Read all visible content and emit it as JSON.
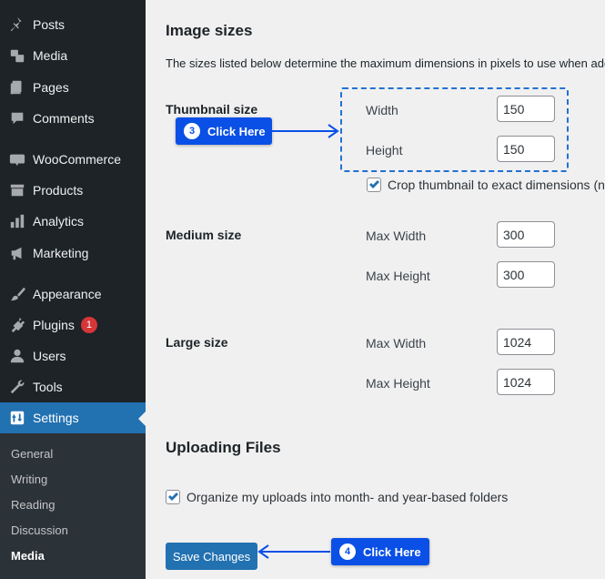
{
  "sidebar": {
    "items": [
      {
        "label": "Posts",
        "icon": "pin-icon"
      },
      {
        "label": "Media",
        "icon": "media-icon"
      },
      {
        "label": "Pages",
        "icon": "pages-icon"
      },
      {
        "label": "Comments",
        "icon": "comment-icon"
      },
      {
        "label": "WooCommerce",
        "icon": "woo-icon"
      },
      {
        "label": "Products",
        "icon": "archive-icon"
      },
      {
        "label": "Analytics",
        "icon": "chart-bar-icon"
      },
      {
        "label": "Marketing",
        "icon": "megaphone-icon"
      },
      {
        "label": "Appearance",
        "icon": "brush-icon"
      },
      {
        "label": "Plugins",
        "icon": "plug-icon",
        "badge": "1"
      },
      {
        "label": "Users",
        "icon": "user-icon"
      },
      {
        "label": "Tools",
        "icon": "wrench-icon"
      },
      {
        "label": "Settings",
        "icon": "settings-icon"
      }
    ],
    "submenu": [
      "General",
      "Writing",
      "Reading",
      "Discussion",
      "Media"
    ]
  },
  "image_sizes": {
    "title": "Image sizes",
    "description": "The sizes listed below determine the maximum dimensions in pixels to use when add",
    "thumbnail": {
      "label": "Thumbnail size",
      "width_label": "Width",
      "width": "150",
      "height_label": "Height",
      "height": "150",
      "crop_label": "Crop thumbnail to exact dimensions (n"
    },
    "medium": {
      "label": "Medium size",
      "width_label": "Max Width",
      "width": "300",
      "height_label": "Max Height",
      "height": "300"
    },
    "large": {
      "label": "Large size",
      "width_label": "Max Width",
      "width": "1024",
      "height_label": "Max Height",
      "height": "1024"
    }
  },
  "uploading": {
    "title": "Uploading Files",
    "organize_label": "Organize my uploads into month- and year-based folders"
  },
  "callouts": {
    "step3": {
      "num": "3",
      "text": "Click Here"
    },
    "step4": {
      "num": "4",
      "text": "Click Here"
    }
  },
  "save_button": "Save Changes",
  "colors": {
    "sidebar_bg": "#1d2327",
    "accent": "#2271b1",
    "callout": "#0a50e6",
    "badge": "#d63638"
  }
}
